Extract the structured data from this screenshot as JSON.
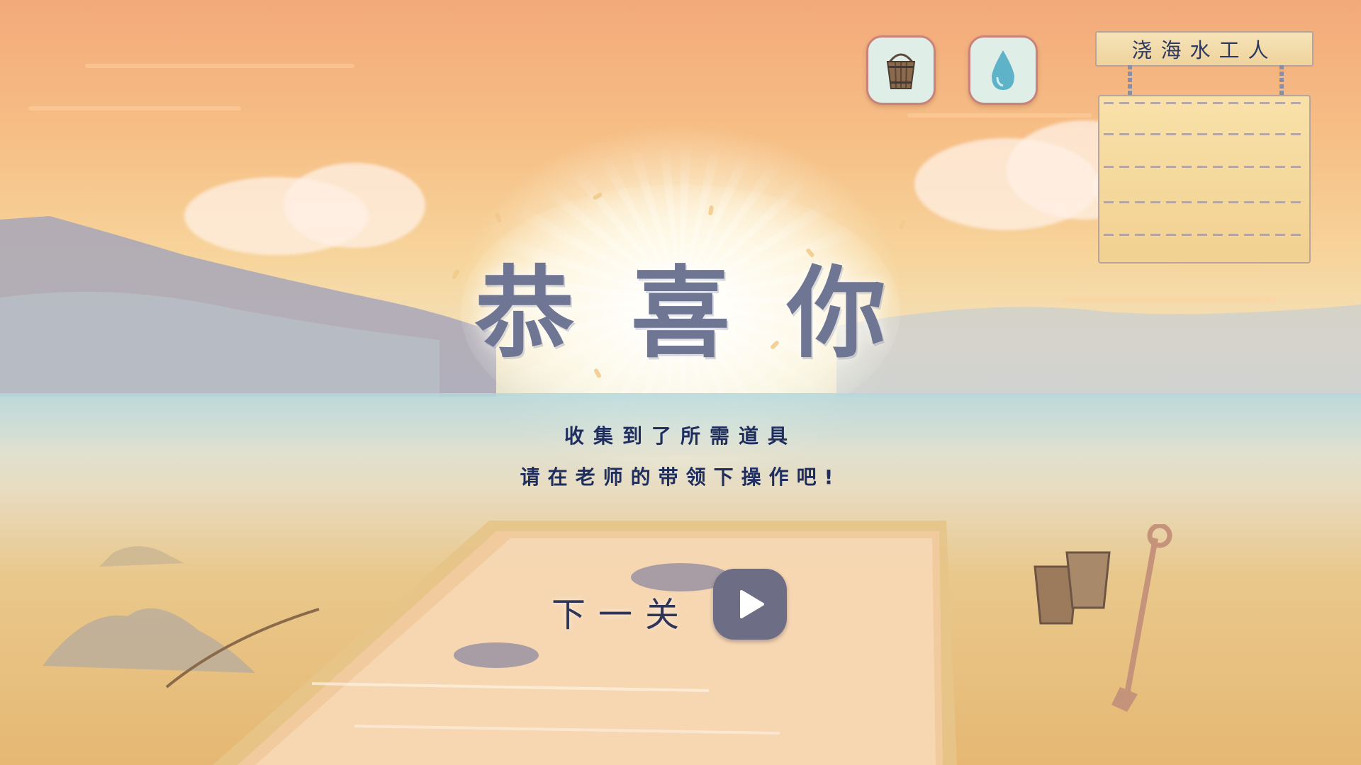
{
  "title": {
    "text": "恭喜你"
  },
  "messages": {
    "line1": "收集到了所需道具",
    "line2": "请在老师的带领下操作吧!"
  },
  "next": {
    "label": "下一关",
    "icon": "play-icon"
  },
  "toolbar": {
    "bucket": {
      "icon": "bucket-icon"
    },
    "water": {
      "icon": "water-drop-icon"
    }
  },
  "sign": {
    "title": "浇海水工人"
  },
  "colors": {
    "accent": "#1f2e5e",
    "button_border": "#c9837c",
    "play_button": "#6e6d86"
  }
}
